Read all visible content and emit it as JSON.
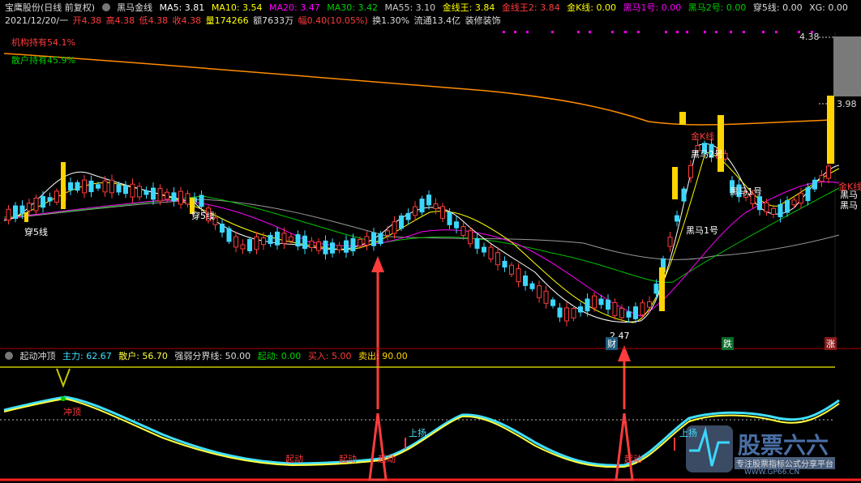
{
  "header": {
    "stock_name": "宝鹰股份(日线 前复权)",
    "indicator_name": "黑马金线",
    "ma5": "MA5: 3.81",
    "ma10": "MA10: 3.54",
    "ma20": "MA20: 3.47",
    "ma30": "MA30: 3.42",
    "ma55": "MA55: 3.10",
    "jxw": "金线王: 3.84",
    "jxw2": "金线王2: 3.84",
    "jk": "金K线: 0.00",
    "hm1": "黑马1号: 0.00",
    "hm2": "黑马2号: 0.00",
    "c5": "穿5线: 0.00",
    "xg": "XG: 0.00"
  },
  "info_row": {
    "date": "2021/12/20/一",
    "open": "开4.38",
    "high": "高4.38",
    "low": "低4.38",
    "close": "收4.38",
    "volume": "量174266",
    "amount": "额7633万",
    "change": "幅0.40(10.05%)",
    "turnover": "换1.30%",
    "float": "流通13.4亿",
    "sector": "装修装饰"
  },
  "overlay_labels": {
    "inst": "机构持有54.1%",
    "retail": "散户持有45.9%",
    "c5a": "穿5线",
    "c5b": "穿5线",
    "hm1": "黑马1号",
    "hm2": "黑马2号",
    "jk1": "金K线",
    "jk2": "金K线",
    "hm_r1": "黑马",
    "hm_r2": "黑马",
    "hm3": "黑马1号",
    "low_val": "2.47",
    "cai": "财",
    "die": "跌",
    "zhang": "涨",
    "price_top": "4.38",
    "price_mid": "3.98"
  },
  "indicator": {
    "name": "起动冲顶",
    "main": "主力: 62.67",
    "retail": "散户: 56.70",
    "line": "强弱分界线: 50.00",
    "start": "起动: 0.00",
    "buy": "买入: 5.00",
    "sell": "卖出: 90.00",
    "chongding": "冲顶",
    "qidong": "起动",
    "shangyang": "上扬"
  },
  "watermark": {
    "title": "股票六六",
    "slogan": "专注股票指标公式分享平台",
    "url": "WWW.GP66.CN"
  },
  "colors": {
    "up": "#ff3c3c",
    "down": "#3cd7ff",
    "ma5": "#ffffff",
    "ma10": "#ffff00",
    "ma20": "#ff00ff",
    "ma30": "#00c000",
    "ma55": "#aaaaaa",
    "long": "#ff8c00",
    "gold": "#ffd400",
    "main_line": "#40e0ff",
    "retail_line": "#ffff40"
  }
}
